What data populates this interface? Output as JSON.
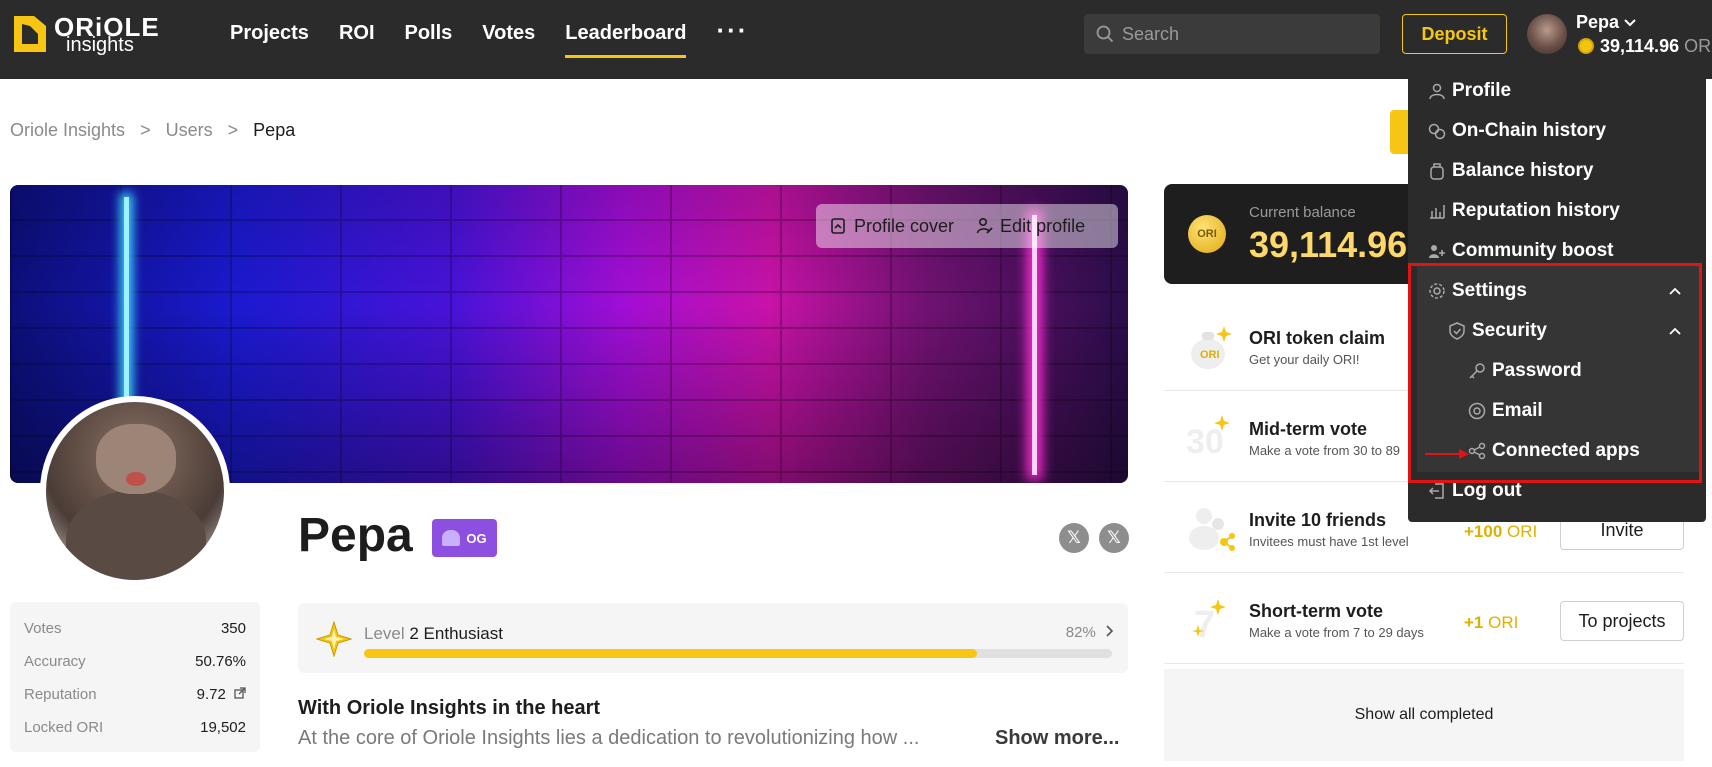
{
  "header": {
    "logo_line1": "ORiOLE",
    "logo_line2": "insights",
    "nav": [
      "Projects",
      "ROI",
      "Polls",
      "Votes",
      "Leaderboard"
    ],
    "nav_active": "Leaderboard",
    "more_label": "···",
    "search_placeholder": "Search",
    "deposit_label": "Deposit",
    "user_name": "Pepa",
    "user_balance": "39,114.96",
    "user_balance_unit": "ORI"
  },
  "breadcrumb": [
    "Oriole Insights",
    "Users",
    "Pepa"
  ],
  "breadcrumb_sep": ">",
  "cover": {
    "cover_button": "Profile cover",
    "edit_button": "Edit profile"
  },
  "profile": {
    "name": "Pepa",
    "badge": "OG",
    "social_1": "𝕏",
    "social_2": "𝕏"
  },
  "stats": [
    {
      "label": "Votes",
      "value": "350"
    },
    {
      "label": "Accuracy",
      "value": "50.76%"
    },
    {
      "label": "Reputation",
      "value": "9.72"
    },
    {
      "label": "Locked ORI",
      "value": "19,502"
    }
  ],
  "level": {
    "prefix": "Level",
    "name": "2 Enthusiast",
    "percent_label": "82%",
    "progress": 0.82
  },
  "about": {
    "title": "With Oriole Insights in the heart",
    "text": "At the core of Oriole Insights lies a dedication to revolutionizing how ...",
    "show_more": "Show more..."
  },
  "balance": {
    "label": "Current balance",
    "value": "39,114.96",
    "coin_text": "ORI"
  },
  "tasks": [
    {
      "title": "ORI token claim",
      "subtitle": "Get your daily ORI!",
      "reward": "",
      "reward_unit": "",
      "button": ""
    },
    {
      "title": "Mid-term vote",
      "subtitle": "Make a vote from 30 to 89",
      "reward": "",
      "reward_unit": "",
      "button": ""
    },
    {
      "title": "Invite 10 friends",
      "subtitle": "Invitees must have 1st level",
      "reward": "+100",
      "reward_unit": "ORI",
      "button": "Invite"
    },
    {
      "title": "Short-term vote",
      "subtitle": "Make a vote from 7 to 29 days",
      "reward": "+1",
      "reward_unit": "ORI",
      "button": "To projects"
    }
  ],
  "show_all": "Show all completed",
  "menu": {
    "profile": "Profile",
    "onchain": "On-Chain history",
    "balance_history": "Balance history",
    "reputation_history": "Reputation history",
    "community_boost": "Community boost",
    "settings": "Settings",
    "security": "Security",
    "password": "Password",
    "email": "Email",
    "connected_apps": "Connected apps",
    "logout": "Log out"
  },
  "colors": {
    "accent": "#f7c614",
    "topbar": "#2b2b2b",
    "highlight": "#e01414",
    "badge": "#8c4fe0"
  }
}
